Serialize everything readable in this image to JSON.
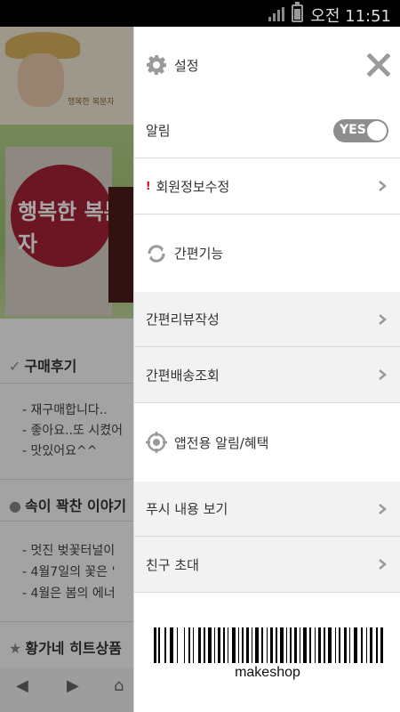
{
  "status_bar": {
    "time": "오전 11:51"
  },
  "background_page": {
    "banner_brand": "행복한 복분자",
    "product_logo": "행복한 복분자",
    "section1_title": "구매후기",
    "reviews": [
      "- 재구매합니다..",
      "- 좋아요..또 시켰어",
      "- 맛있어요^^"
    ],
    "section2_title": "속이 꽉찬 이야기",
    "stories": [
      "- 멋진 벚꽃터널이",
      "- 4월7일의 꽃은 '",
      "- 4월은 봄의 에너"
    ],
    "section3_title": "황가네 히트상품"
  },
  "drawer": {
    "settings_label": "설정",
    "notification_label": "알림",
    "notification_toggle": "YES",
    "member_edit_label": "회원정보수정",
    "quick_features_label": "간편기능",
    "quick_review_label": "간편리뷰작성",
    "quick_delivery_label": "간편배송조회",
    "app_notice_label": "앱전용 알림/혜택",
    "push_view_label": "푸시 내용 보기",
    "invite_friend_label": "친구 초대",
    "barcode_text": "makeshop"
  },
  "colors": {
    "drawer_bg": "#ffffff",
    "section_gray": "#f2f2f2",
    "toggle_bg": "#8e8e8e",
    "alert_red": "#d0021b",
    "icon_gray": "#9a9a9a"
  },
  "icons": [
    "gear-icon",
    "close-icon",
    "exclamation-icon",
    "chevron-right-icon",
    "refresh-icon",
    "crosshair-icon"
  ]
}
